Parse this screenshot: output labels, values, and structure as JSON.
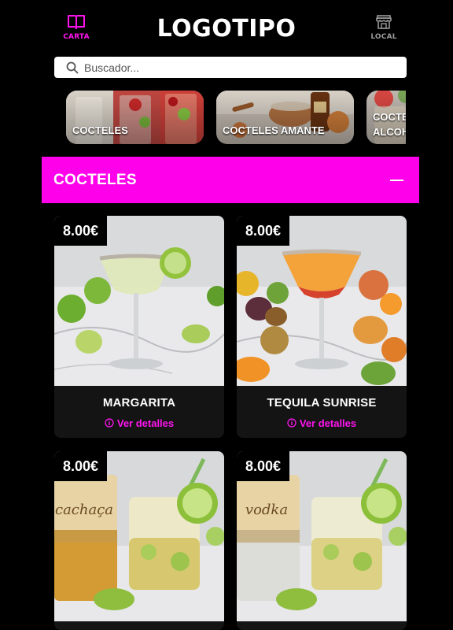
{
  "header": {
    "nav_left": {
      "label": "CARTA",
      "icon": "book-open-icon"
    },
    "logo": "LOGOTIPO",
    "nav_right": {
      "label": "LOCAL",
      "icon": "store-icon"
    }
  },
  "search": {
    "placeholder": "Buscador...",
    "value": "",
    "icon": "search-icon"
  },
  "categories": [
    {
      "label": "COCTELES"
    },
    {
      "label": "COCTELES AMANTE"
    },
    {
      "label_line1": "COCTE",
      "label_line2": "ALCOH"
    }
  ],
  "section": {
    "title": "COCTELES",
    "toggle_icon": "minus-icon"
  },
  "products": [
    {
      "price": "8.00€",
      "name": "MARGARITA",
      "details": "Ver detalles"
    },
    {
      "price": "8.00€",
      "name": "TEQUILA SUNRISE",
      "details": "Ver detalles"
    },
    {
      "price": "8.00€",
      "bottle_label": "cachaça"
    },
    {
      "price": "8.00€",
      "bottle_label": "vodka"
    }
  ],
  "colors": {
    "accent": "#ff00ea",
    "background": "#000000",
    "card": "#141414"
  }
}
